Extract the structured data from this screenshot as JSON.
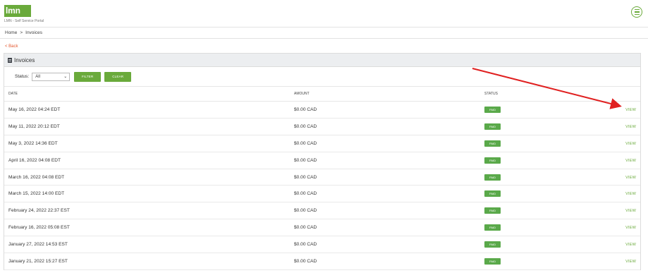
{
  "header": {
    "logo_text": "lmn",
    "portal_name": "LMN - Self Service Portal"
  },
  "breadcrumb": {
    "home": "Home",
    "separator": ">",
    "current": "Invoices"
  },
  "back_link": "< Back",
  "panel": {
    "title": "Invoices"
  },
  "filter": {
    "status_label": "Status:",
    "status_value": "All",
    "filter_button": "FILTER",
    "clear_button": "CLEAR"
  },
  "table": {
    "headers": {
      "date": "DATE",
      "amount": "AMOUNT",
      "status": "STATUS"
    },
    "rows": [
      {
        "date": "May 16, 2022 04:24 EDT",
        "amount": "$0.00 CAD",
        "status": "PAID",
        "action": "VIEW"
      },
      {
        "date": "May 11, 2022 20:12 EDT",
        "amount": "$0.00 CAD",
        "status": "PAID",
        "action": "VIEW"
      },
      {
        "date": "May 3, 2022 14:36 EDT",
        "amount": "$0.00 CAD",
        "status": "PAID",
        "action": "VIEW"
      },
      {
        "date": "April 16, 2022 04:08 EDT",
        "amount": "$0.00 CAD",
        "status": "PAID",
        "action": "VIEW"
      },
      {
        "date": "March 16, 2022 04:08 EDT",
        "amount": "$0.00 CAD",
        "status": "PAID",
        "action": "VIEW"
      },
      {
        "date": "March 15, 2022 14:00 EDT",
        "amount": "$0.00 CAD",
        "status": "PAID",
        "action": "VIEW"
      },
      {
        "date": "February 24, 2022 22:37 EST",
        "amount": "$0.00 CAD",
        "status": "PAID",
        "action": "VIEW"
      },
      {
        "date": "February 16, 2022 05:08 EST",
        "amount": "$0.00 CAD",
        "status": "PAID",
        "action": "VIEW"
      },
      {
        "date": "January 27, 2022 14:53 EST",
        "amount": "$0.00 CAD",
        "status": "PAID",
        "action": "VIEW"
      },
      {
        "date": "January 21, 2022 15:27 EST",
        "amount": "$0.00 CAD",
        "status": "PAID",
        "action": "VIEW"
      }
    ]
  },
  "colors": {
    "brand_green": "#6aaa3b",
    "badge_green": "#5aa94a",
    "back_link": "#e4572e",
    "annotation_arrow": "#e02020"
  },
  "icons": {
    "menu": "hamburger-circle-icon",
    "panel": "invoice-icon",
    "select_caret": "chevron-down-icon"
  }
}
